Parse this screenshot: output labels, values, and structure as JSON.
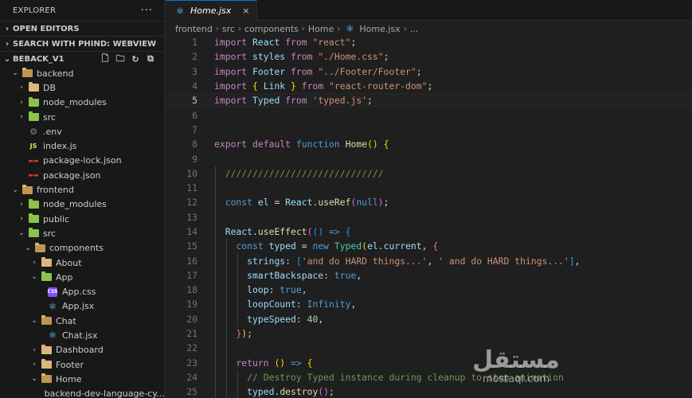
{
  "sidebar": {
    "title": "EXPLORER",
    "more": "···",
    "sections": {
      "open_editors": "OPEN EDITORS",
      "search_phind": "SEARCH WITH PHIND: WEBVIEW",
      "project": "BEBACK_V1"
    },
    "tree": [
      {
        "label": "backend",
        "depth": 1,
        "chev": "open",
        "icon": "folder-open"
      },
      {
        "label": "DB",
        "depth": 2,
        "chev": "closed",
        "icon": "folder"
      },
      {
        "label": "node_modules",
        "depth": 2,
        "chev": "closed",
        "icon": "folder-nm"
      },
      {
        "label": "src",
        "depth": 2,
        "chev": "closed",
        "icon": "folder-green"
      },
      {
        "label": ".env",
        "depth": 2,
        "chev": "none",
        "icon": "env"
      },
      {
        "label": "index.js",
        "depth": 2,
        "chev": "none",
        "icon": "js"
      },
      {
        "label": "package-lock.json",
        "depth": 2,
        "chev": "none",
        "icon": "npm"
      },
      {
        "label": "package.json",
        "depth": 2,
        "chev": "none",
        "icon": "npm"
      },
      {
        "label": "frontend",
        "depth": 1,
        "chev": "open",
        "icon": "folder-open"
      },
      {
        "label": "node_modules",
        "depth": 2,
        "chev": "closed",
        "icon": "folder-nm"
      },
      {
        "label": "public",
        "depth": 2,
        "chev": "closed",
        "icon": "folder-green"
      },
      {
        "label": "src",
        "depth": 2,
        "chev": "open",
        "icon": "folder-green"
      },
      {
        "label": "components",
        "depth": 3,
        "chev": "open",
        "icon": "folder-open"
      },
      {
        "label": "About",
        "depth": 4,
        "chev": "closed",
        "icon": "folder"
      },
      {
        "label": "App",
        "depth": 4,
        "chev": "open",
        "icon": "folder-green"
      },
      {
        "label": "App.css",
        "depth": 5,
        "chev": "none",
        "icon": "css"
      },
      {
        "label": "App.jsx",
        "depth": 5,
        "chev": "none",
        "icon": "react"
      },
      {
        "label": "Chat",
        "depth": 4,
        "chev": "open",
        "icon": "folder-open"
      },
      {
        "label": "Chat.jsx",
        "depth": 5,
        "chev": "none",
        "icon": "react"
      },
      {
        "label": "Dashboard",
        "depth": 4,
        "chev": "closed",
        "icon": "folder"
      },
      {
        "label": "Footer",
        "depth": 4,
        "chev": "closed",
        "icon": "folder"
      },
      {
        "label": "Home",
        "depth": 4,
        "chev": "open",
        "icon": "folder-open"
      },
      {
        "label": "backend-dev-language-cy...",
        "depth": 5,
        "chev": "none",
        "icon": "img"
      }
    ]
  },
  "editor": {
    "tab": {
      "label": "Home.jsx",
      "close": "×"
    },
    "breadcrumb": [
      "frontend",
      "src",
      "components",
      "Home",
      "Home.jsx",
      "..."
    ],
    "current_line": 5,
    "lines": [
      [
        [
          "kw",
          "import"
        ],
        [
          "pn",
          " "
        ],
        [
          "var",
          "React"
        ],
        [
          "pn",
          " "
        ],
        [
          "kw",
          "from"
        ],
        [
          "pn",
          " "
        ],
        [
          "str",
          "\"react\""
        ],
        [
          "pn",
          ";"
        ]
      ],
      [
        [
          "kw",
          "import"
        ],
        [
          "pn",
          " "
        ],
        [
          "var",
          "styles"
        ],
        [
          "pn",
          " "
        ],
        [
          "kw",
          "from"
        ],
        [
          "pn",
          " "
        ],
        [
          "str",
          "\"./Home.css\""
        ],
        [
          "pn",
          ";"
        ]
      ],
      [
        [
          "kw",
          "import"
        ],
        [
          "pn",
          " "
        ],
        [
          "var",
          "Footer"
        ],
        [
          "pn",
          " "
        ],
        [
          "kw",
          "from"
        ],
        [
          "pn",
          " "
        ],
        [
          "str",
          "\"../Footer/Footer\""
        ],
        [
          "pn",
          ";"
        ]
      ],
      [
        [
          "kw",
          "import"
        ],
        [
          "pn",
          " "
        ],
        [
          "br1",
          "{"
        ],
        [
          "pn",
          " "
        ],
        [
          "var",
          "Link"
        ],
        [
          "pn",
          " "
        ],
        [
          "br1",
          "}"
        ],
        [
          "pn",
          " "
        ],
        [
          "kw",
          "from"
        ],
        [
          "pn",
          " "
        ],
        [
          "str",
          "\"react-router-dom\""
        ],
        [
          "pn",
          ";"
        ]
      ],
      [
        [
          "kw",
          "import"
        ],
        [
          "pn",
          " "
        ],
        [
          "var",
          "Typed"
        ],
        [
          "pn",
          " "
        ],
        [
          "kw",
          "from"
        ],
        [
          "pn",
          " "
        ],
        [
          "str",
          "'typed.js'"
        ],
        [
          "pn",
          ";"
        ]
      ],
      [],
      [],
      [
        [
          "kw",
          "export"
        ],
        [
          "pn",
          " "
        ],
        [
          "kw",
          "default"
        ],
        [
          "pn",
          " "
        ],
        [
          "kw2",
          "function"
        ],
        [
          "pn",
          " "
        ],
        [
          "fn",
          "Home"
        ],
        [
          "br1",
          "()"
        ],
        [
          "pn",
          " "
        ],
        [
          "br1",
          "{"
        ]
      ],
      [],
      [
        [
          "pn",
          "  "
        ],
        [
          "cmt",
          "/////////////////////////////"
        ]
      ],
      [],
      [
        [
          "pn",
          "  "
        ],
        [
          "kw2",
          "const"
        ],
        [
          "pn",
          " "
        ],
        [
          "var",
          "el"
        ],
        [
          "pn",
          " = "
        ],
        [
          "var",
          "React"
        ],
        [
          "pn",
          "."
        ],
        [
          "fn",
          "useRef"
        ],
        [
          "br2",
          "("
        ],
        [
          "kw2",
          "null"
        ],
        [
          "br2",
          ")"
        ],
        [
          "pn",
          ";"
        ]
      ],
      [],
      [
        [
          "pn",
          "  "
        ],
        [
          "var",
          "React"
        ],
        [
          "pn",
          "."
        ],
        [
          "fn",
          "useEffect"
        ],
        [
          "br2",
          "("
        ],
        [
          "br3",
          "()"
        ],
        [
          "pn",
          " "
        ],
        [
          "kw2",
          "=>"
        ],
        [
          "pn",
          " "
        ],
        [
          "br3",
          "{"
        ]
      ],
      [
        [
          "pn",
          "    "
        ],
        [
          "kw2",
          "const"
        ],
        [
          "pn",
          " "
        ],
        [
          "var",
          "typed"
        ],
        [
          "pn",
          " = "
        ],
        [
          "kw2",
          "new"
        ],
        [
          "pn",
          " "
        ],
        [
          "cls",
          "Typed"
        ],
        [
          "br1",
          "("
        ],
        [
          "var",
          "el"
        ],
        [
          "pn",
          "."
        ],
        [
          "var",
          "current"
        ],
        [
          "pn",
          ", "
        ],
        [
          "br2",
          "{"
        ]
      ],
      [
        [
          "pn",
          "      "
        ],
        [
          "var",
          "strings"
        ],
        [
          "pn",
          ": "
        ],
        [
          "br3",
          "["
        ],
        [
          "str",
          "'and do HARD things...'"
        ],
        [
          "pn",
          ", "
        ],
        [
          "str",
          "' and do HARD things...'"
        ],
        [
          "br3",
          "]"
        ],
        [
          "pn",
          ","
        ]
      ],
      [
        [
          "pn",
          "      "
        ],
        [
          "var",
          "smartBackspace"
        ],
        [
          "pn",
          ": "
        ],
        [
          "kw2",
          "true"
        ],
        [
          "pn",
          ","
        ]
      ],
      [
        [
          "pn",
          "      "
        ],
        [
          "var",
          "loop"
        ],
        [
          "pn",
          ": "
        ],
        [
          "kw2",
          "true"
        ],
        [
          "pn",
          ","
        ]
      ],
      [
        [
          "pn",
          "      "
        ],
        [
          "var",
          "loopCount"
        ],
        [
          "pn",
          ": "
        ],
        [
          "kw2",
          "Infinity"
        ],
        [
          "pn",
          ","
        ]
      ],
      [
        [
          "pn",
          "      "
        ],
        [
          "var",
          "typeSpeed"
        ],
        [
          "pn",
          ": "
        ],
        [
          "num",
          "40"
        ],
        [
          "pn",
          ","
        ]
      ],
      [
        [
          "pn",
          "    "
        ],
        [
          "br2",
          "}"
        ],
        [
          "br1",
          ")"
        ],
        [
          "pn",
          ";"
        ]
      ],
      [],
      [
        [
          "pn",
          "    "
        ],
        [
          "kw",
          "return"
        ],
        [
          "pn",
          " "
        ],
        [
          "br1",
          "()"
        ],
        [
          "pn",
          " "
        ],
        [
          "kw2",
          "=>"
        ],
        [
          "pn",
          " "
        ],
        [
          "br1",
          "{"
        ]
      ],
      [
        [
          "pn",
          "      "
        ],
        [
          "cmt",
          "// Destroy Typed instance during cleanup to stop animation"
        ]
      ],
      [
        [
          "pn",
          "      "
        ],
        [
          "var",
          "typed"
        ],
        [
          "pn",
          "."
        ],
        [
          "fn",
          "destroy"
        ],
        [
          "br2",
          "()"
        ],
        [
          "pn",
          ";"
        ]
      ]
    ]
  },
  "watermark": {
    "main": "مستقل",
    "sub": "mostaql.com"
  }
}
